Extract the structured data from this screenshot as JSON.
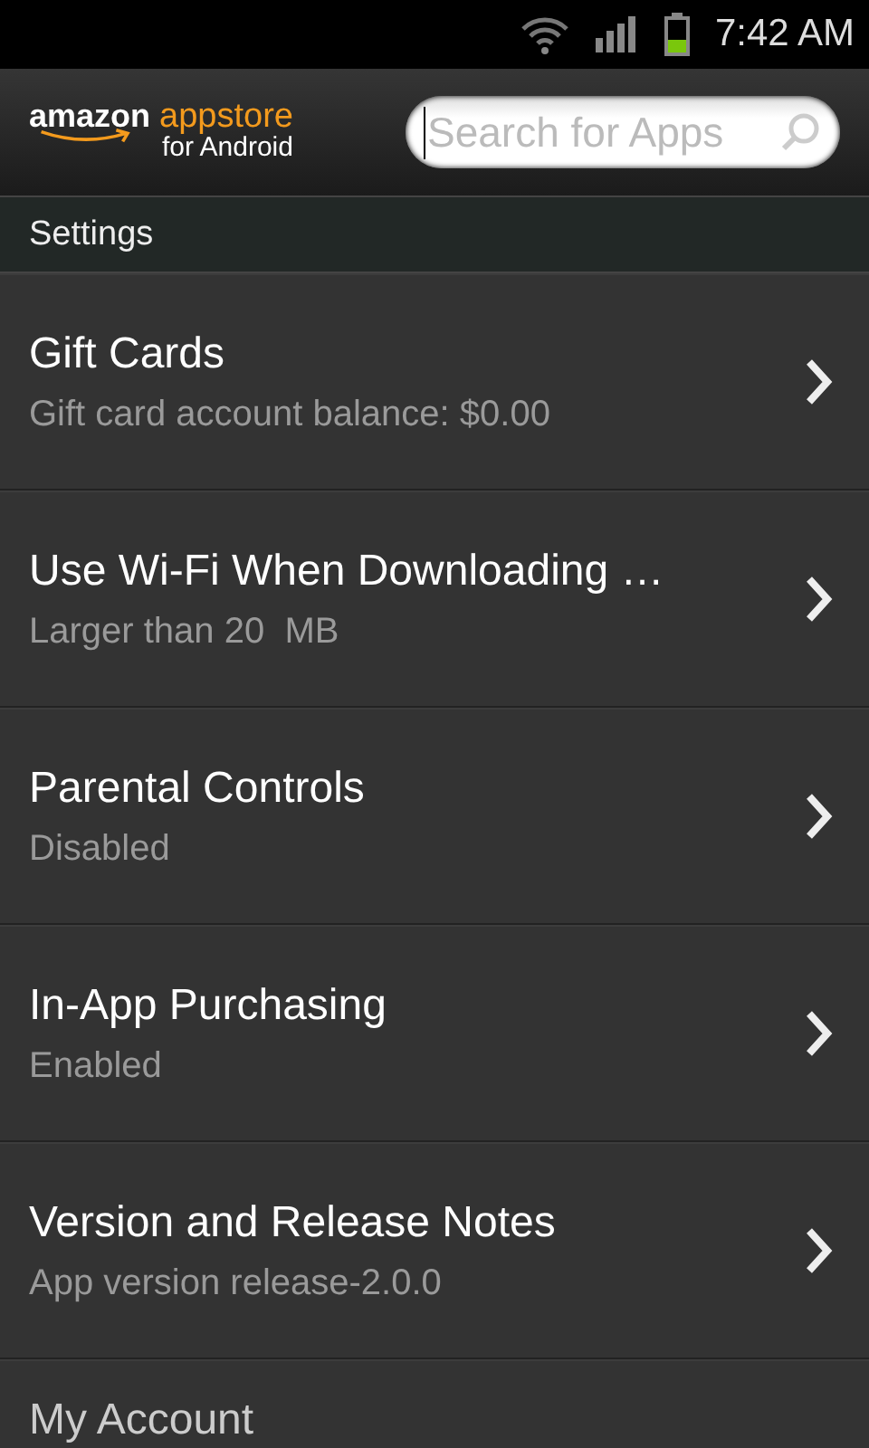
{
  "status_bar": {
    "time": "7:42 AM"
  },
  "header": {
    "logo": {
      "brand": "amazon",
      "product": "appstore",
      "platform": "for Android"
    },
    "search": {
      "placeholder": "Search for Apps"
    }
  },
  "section_title": "Settings",
  "items": [
    {
      "title": "Gift Cards",
      "subtitle": "Gift card account balance: $0.00"
    },
    {
      "title": "Use Wi-Fi When Downloading …",
      "subtitle": "Larger than 20  MB"
    },
    {
      "title": "Parental Controls",
      "subtitle": "Disabled"
    },
    {
      "title": "In-App Purchasing",
      "subtitle": "Enabled"
    },
    {
      "title": "Version and Release Notes",
      "subtitle": "App version release-2.0.0"
    },
    {
      "title": "My Account"
    }
  ]
}
